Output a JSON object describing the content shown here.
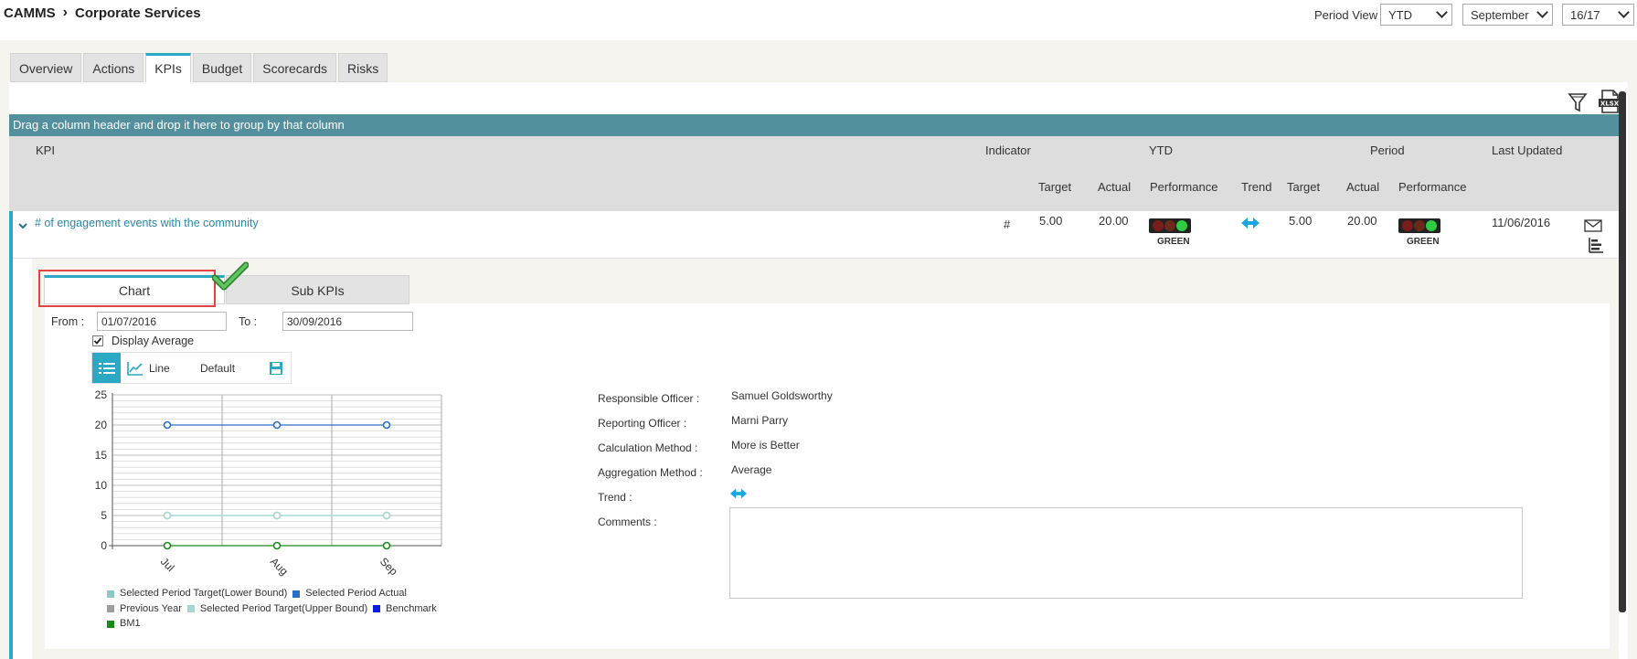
{
  "breadcrumb": {
    "root": "CAMMS",
    "current": "Corporate Services"
  },
  "period": {
    "label": "Period View",
    "view": "YTD",
    "month": "September",
    "year": "16/17"
  },
  "tabs": [
    "Overview",
    "Actions",
    "KPIs",
    "Budget",
    "Scorecards",
    "Risks"
  ],
  "active_tab": "KPIs",
  "group_bar": "Drag a column header and drop it here to group by that column",
  "grid_header": {
    "kpi": "KPI",
    "indicator": "Indicator",
    "ytd": "YTD",
    "period": "Period",
    "last_updated": "Last Updated",
    "target": "Target",
    "actual": "Actual",
    "performance": "Performance",
    "trend": "Trend"
  },
  "row": {
    "kpi": "# of engagement events with the community",
    "indicator": "#",
    "ytd_target": "5.00",
    "ytd_actual": "20.00",
    "ytd_performance": "GREEN",
    "period_target": "5.00",
    "period_actual": "20.00",
    "period_performance": "GREEN",
    "last_updated": "11/06/2016",
    "trend_icon": "bidirectional-arrow-icon"
  },
  "subtabs": [
    "Chart",
    "Sub KPIs"
  ],
  "filters": {
    "from_label": "From :",
    "from_value": "01/07/2016",
    "to_label": "To :",
    "to_value": "30/09/2016",
    "display_average_label": "Display Average",
    "display_average_checked": true
  },
  "chart_toolbar": {
    "line_label": "Line",
    "default_label": "Default"
  },
  "details": {
    "responsible_officer_label": "Responsible Officer :",
    "responsible_officer": "Samuel Goldsworthy",
    "reporting_officer_label": "Reporting Officer :",
    "reporting_officer": "Marni Parry",
    "calculation_method_label": "Calculation Method :",
    "calculation_method": "More is Better",
    "aggregation_method_label": "Aggregation Method :",
    "aggregation_method": "Average",
    "trend_label": "Trend :",
    "comments_label": "Comments :"
  },
  "chart_data": {
    "type": "line",
    "categories": [
      "Jul",
      "Aug",
      "Sep"
    ],
    "ylim": [
      0,
      25
    ],
    "yticks": [
      0,
      5,
      10,
      15,
      20,
      25
    ],
    "series": [
      {
        "name": "Selected Period Target(Lower Bound)",
        "values": [
          5,
          5,
          5
        ],
        "color": "#8fc7c5"
      },
      {
        "name": "Selected Period Actual",
        "values": [
          20,
          20,
          20
        ],
        "color": "#2b6fc4"
      },
      {
        "name": "Previous Year",
        "values": [],
        "color": "#9e9e9e"
      },
      {
        "name": "Selected Period Target(Upper Bound)",
        "values": [
          5,
          5,
          5
        ],
        "color": "#a9d6d4"
      },
      {
        "name": "Benchmark",
        "values": [],
        "color": "#0a1ee0"
      },
      {
        "name": "BM1",
        "values": [
          0,
          0,
          0
        ],
        "color": "#1a8a1a"
      }
    ]
  },
  "colors": {
    "accent": "#2aa8c4",
    "group_bar": "#538f9c",
    "link": "#2b86a6"
  }
}
